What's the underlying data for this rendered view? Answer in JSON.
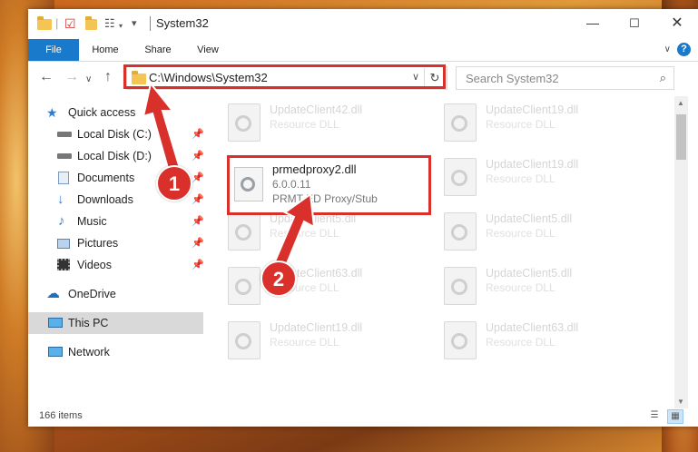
{
  "window": {
    "title": "System32"
  },
  "ribbon": {
    "tabs": [
      "File",
      "Home",
      "Share",
      "View"
    ],
    "help": "?"
  },
  "address": {
    "path": "C:\\Windows\\System32"
  },
  "search": {
    "placeholder": "Search System32"
  },
  "nav": {
    "items": [
      {
        "label": "Quick access",
        "icon": "star-icon",
        "pinned": false
      },
      {
        "label": "Local Disk (C:)",
        "icon": "drive-icon",
        "pinned": true
      },
      {
        "label": "Local Disk (D:)",
        "icon": "drive-icon",
        "pinned": true
      },
      {
        "label": "Documents",
        "icon": "documents-icon",
        "pinned": true
      },
      {
        "label": "Downloads",
        "icon": "download-icon",
        "pinned": true
      },
      {
        "label": "Music",
        "icon": "music-icon",
        "pinned": true
      },
      {
        "label": "Pictures",
        "icon": "pictures-icon",
        "pinned": true
      },
      {
        "label": "Videos",
        "icon": "videos-icon",
        "pinned": true
      },
      {
        "label": "OneDrive",
        "icon": "cloud-icon",
        "pinned": false
      },
      {
        "label": "This PC",
        "icon": "computer-icon",
        "pinned": false,
        "selected": true
      },
      {
        "label": "Network",
        "icon": "network-icon",
        "pinned": false
      }
    ]
  },
  "files": [
    {
      "name": "UpdateClient42.dll",
      "desc": "Resource DLL"
    },
    {
      "name": "UpdateClient19.dll",
      "desc": "Resource DLL"
    },
    {
      "name": "UpdateClient19.dll",
      "desc": "Resource DLL"
    },
    {
      "name": "UpdateClient5.dll",
      "desc": "Resource DLL"
    },
    {
      "name": "UpdateClient5.dll",
      "desc": "Resource DLL"
    },
    {
      "name": "UpdateClient63.dll",
      "desc": "Resource DLL"
    },
    {
      "name": "UpdateClient5.dll",
      "desc": "Resource DLL"
    },
    {
      "name": "UpdateClient19.dll",
      "desc": "Resource DLL"
    },
    {
      "name": "UpdateClient63.dll",
      "desc": "Resource DLL"
    }
  ],
  "highlighted_file": {
    "name": "prmedproxy2.dll",
    "version": "6.0.0.11",
    "description": "PRMT ED Proxy/Stub"
  },
  "status": {
    "items_count": "166 items"
  },
  "annotations": {
    "badge1": "1",
    "badge2": "2",
    "color": "#d9302c"
  }
}
